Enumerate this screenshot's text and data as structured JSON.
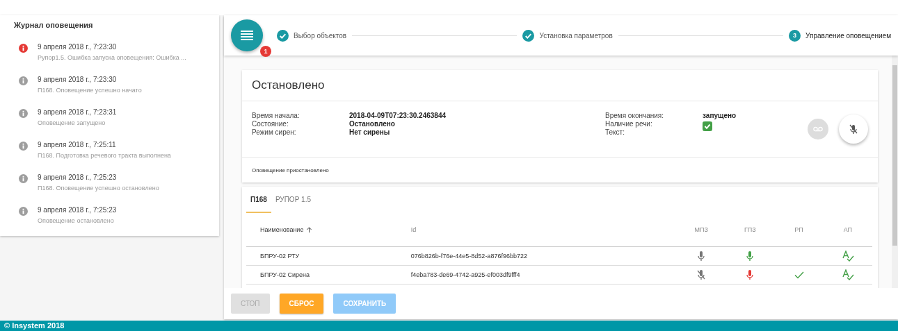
{
  "log": {
    "title": "Журнал оповещения",
    "items": [
      {
        "kind": "error",
        "time": "9 апреля 2018 г., 7:23:30",
        "text": "Рупор1.5. Ошибка запуска оповещения: Ошибка ..."
      },
      {
        "kind": "info",
        "time": "9 апреля 2018 г., 7:23:30",
        "text": "П168. Оповещение успешно начато"
      },
      {
        "kind": "info",
        "time": "9 апреля 2018 г., 7:23:31",
        "text": "Оповещение запущено"
      },
      {
        "kind": "info",
        "time": "9 апреля 2018 г., 7:25:11",
        "text": "П168. Подготовка речевого тракта выполнена"
      },
      {
        "kind": "info",
        "time": "9 апреля 2018 г., 7:25:23",
        "text": "П168. Оповещение успешно остановлено"
      },
      {
        "kind": "info",
        "time": "9 апреля 2018 г., 7:25:23",
        "text": "Оповещение остановлено"
      }
    ]
  },
  "menu": {
    "badge": "1"
  },
  "steps": [
    {
      "label": "Выбор объектов",
      "done": true
    },
    {
      "label": "Установка параметров",
      "done": true
    },
    {
      "label": "Управление оповещением",
      "number": "3",
      "done": false
    }
  ],
  "status": {
    "title": "Остановлено",
    "left": [
      {
        "label": "Время начала:",
        "value": "2018-04-09T07:23:30.2463844"
      },
      {
        "label": "Состояние:",
        "value": "Остановлено"
      },
      {
        "label": "Режим сирен:",
        "value": "Нет сирены"
      }
    ],
    "end_label": "Время окончания:",
    "end_value": "запущено",
    "speech_label": "Наличие речи:",
    "speech_checked": true,
    "text_label": "Текст:",
    "note": "Оповещение приостановлено"
  },
  "tabs": [
    {
      "label": "П168",
      "selected": true
    },
    {
      "label": "РУПОР 1.5",
      "selected": false
    }
  ],
  "table": {
    "columns": [
      "Наименование",
      "Id",
      "МПЗ",
      "ГПЗ",
      "РП",
      "АП"
    ],
    "rows": [
      {
        "name": "БПРУ-02 РТУ",
        "id": "076b826b-f76e-44e5-8d52-a876f96bb722",
        "mpz_muted": false,
        "gpz_ok": true,
        "rp_checked": false,
        "ap": true
      },
      {
        "name": "БПРУ-02 Сирена",
        "id": "f4eba783-de69-4742-a925-ef003df9fff4",
        "mpz_muted": true,
        "gpz_ok": false,
        "rp_checked": true,
        "ap": true
      }
    ]
  },
  "buttons": [
    {
      "label": "СТОП",
      "kind": "disabled"
    },
    {
      "label": "СБРОС",
      "kind": "warn"
    },
    {
      "label": "СОХРАНИТЬ",
      "kind": "faded"
    }
  ],
  "footer": "© Insystem 2018"
}
